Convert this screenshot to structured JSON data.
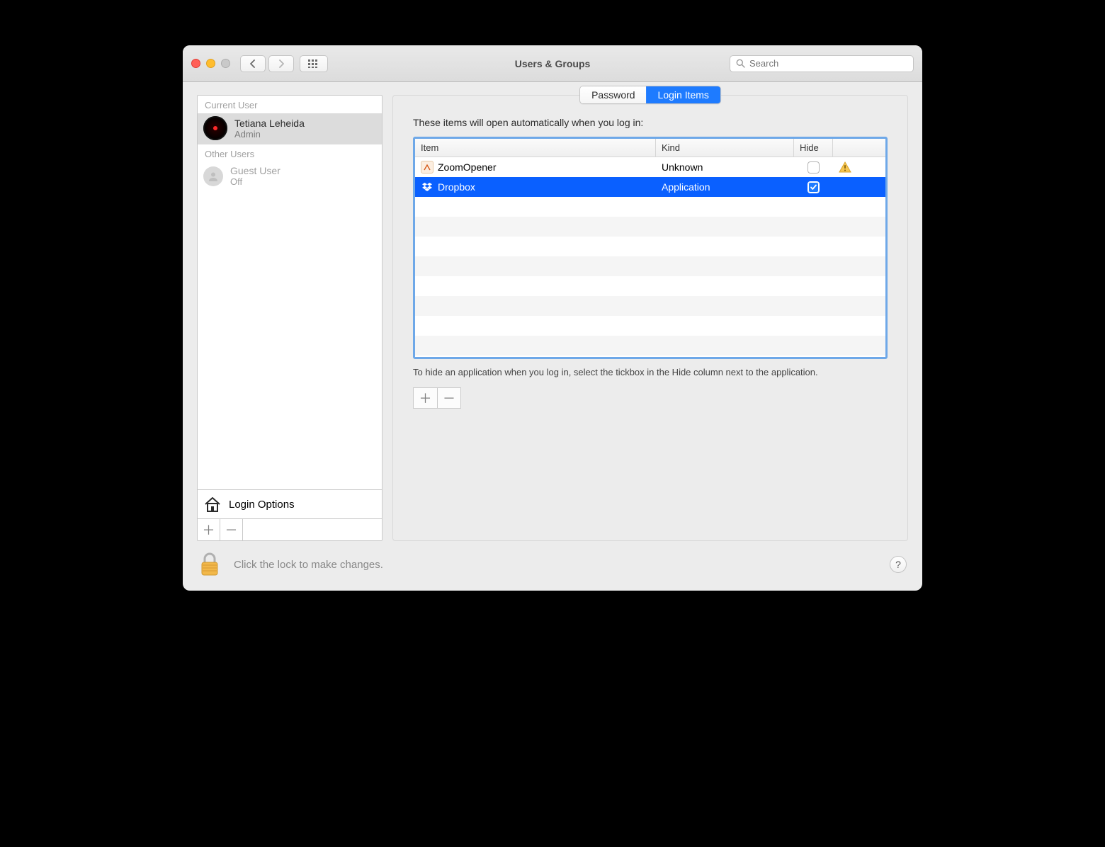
{
  "window": {
    "title": "Users & Groups"
  },
  "search": {
    "placeholder": "Search"
  },
  "sidebar": {
    "current_user_header": "Current User",
    "other_users_header": "Other Users",
    "current": {
      "name": "Tetiana Leheida",
      "role": "Admin"
    },
    "guest": {
      "name": "Guest User",
      "status": "Off"
    },
    "login_options": "Login Options"
  },
  "tabs": {
    "password": "Password",
    "login_items": "Login Items",
    "active": "login_items"
  },
  "panel": {
    "heading": "These items will open automatically when you log in:",
    "columns": {
      "item": "Item",
      "kind": "Kind",
      "hide": "Hide"
    },
    "rows": [
      {
        "name": "ZoomOpener",
        "kind": "Unknown",
        "hide": false,
        "selected": false,
        "warning": true,
        "icon": "zoom"
      },
      {
        "name": "Dropbox",
        "kind": "Application",
        "hide": true,
        "selected": true,
        "warning": false,
        "icon": "dropbox"
      }
    ],
    "hint": "To hide an application when you log in, select the tickbox in the Hide column next to the application."
  },
  "footer": {
    "lock_text": "Click the lock to make changes.",
    "help": "?"
  },
  "glyphs": {
    "plus": "＋",
    "minus": "－"
  }
}
